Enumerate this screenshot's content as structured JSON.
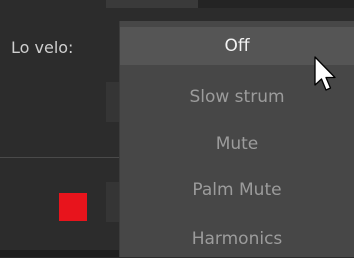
{
  "field": {
    "label": "Lo velo:"
  },
  "dropdown": {
    "selected_index": 0,
    "items": [
      {
        "label": "Off"
      },
      {
        "label": "Slow strum"
      },
      {
        "label": "Mute"
      },
      {
        "label": "Palm Mute"
      },
      {
        "label": "Harmonics"
      }
    ]
  },
  "colors": {
    "background": "#2c2c2c",
    "menu_background": "#474747",
    "menu_selected": "#555555",
    "menu_text": "#9c9c9c",
    "selected_text": "#f2f2f2",
    "indicator_red": "#e8141c"
  },
  "icons": {
    "cursor": "mouse-pointer-icon"
  }
}
